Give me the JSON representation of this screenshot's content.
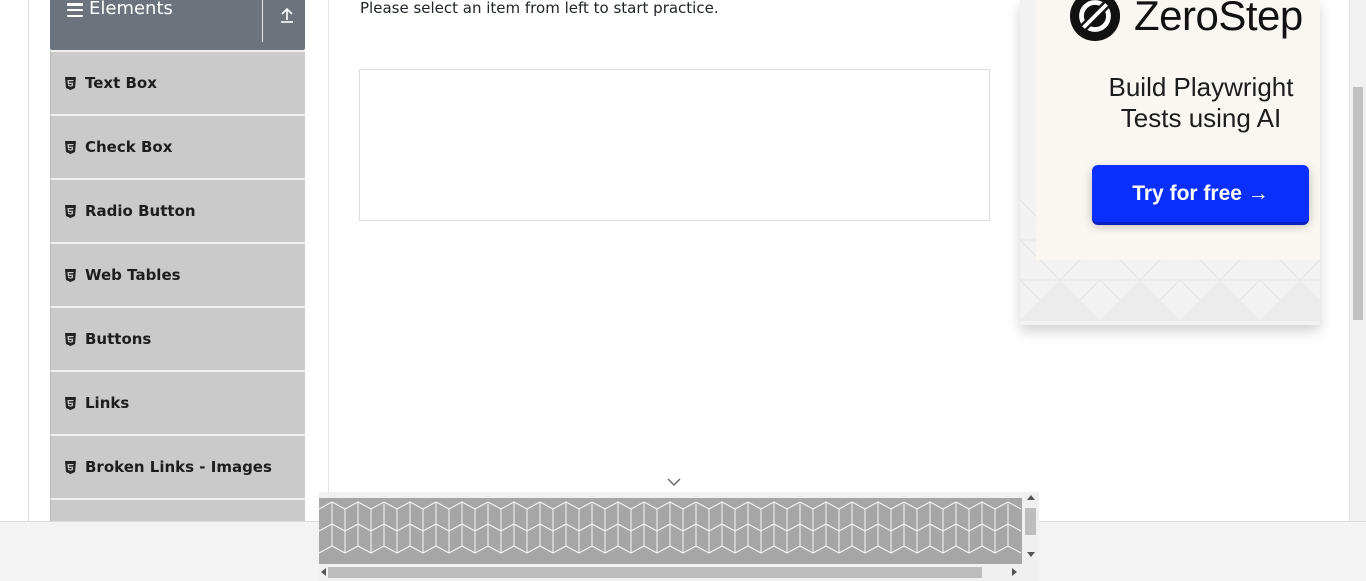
{
  "sidebar": {
    "group_title": "Elements",
    "items": [
      {
        "label": "Text Box"
      },
      {
        "label": "Check Box"
      },
      {
        "label": "Radio Button"
      },
      {
        "label": "Web Tables"
      },
      {
        "label": "Buttons"
      },
      {
        "label": "Links"
      },
      {
        "label": "Broken Links - Images"
      }
    ]
  },
  "main": {
    "intro_text": "Please select an item from left to start practice."
  },
  "ad": {
    "brand": "ZeroStep",
    "headline_line1": "Build Playwright",
    "headline_line2": "Tests using AI",
    "cta_label": "Try for free →",
    "colors": {
      "cta_background": "#0b2ffb",
      "card_background": "#faf7f2"
    }
  },
  "icons": {
    "menu_toggle": "hamburger-icon",
    "collapse": "arrow-up-icon",
    "item": "html5-icon",
    "expand_ad": "chevron-down-icon"
  },
  "theme": {
    "sidebar_header_bg": "#6c737d",
    "menu_item_bg": "#cacaca"
  }
}
